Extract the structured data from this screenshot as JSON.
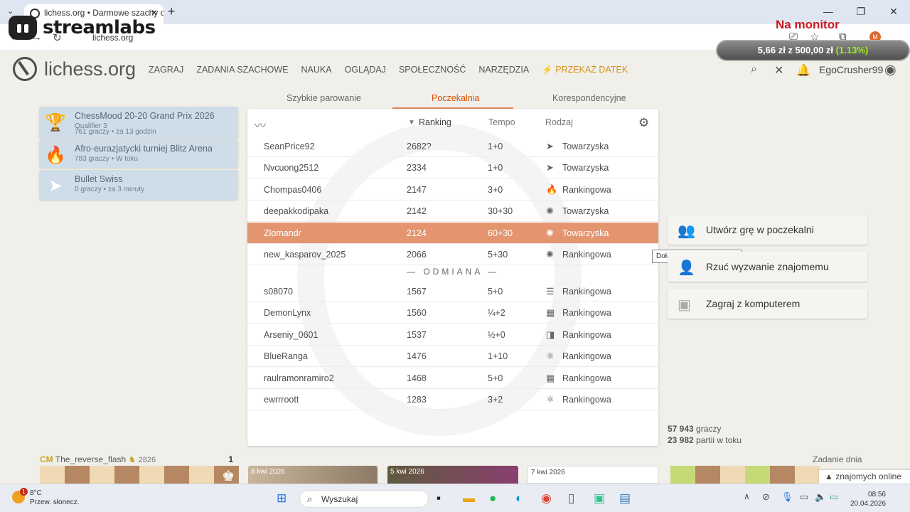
{
  "browser": {
    "tab_title": "lichess.org • Darmowe szachy o",
    "url": "lichess.org",
    "profile_initial": "M"
  },
  "stream": {
    "brand": "streamlabs",
    "monitor_label": "Na monitor",
    "donation_amount": "5,66 zł",
    "donation_goal": "z 500,00 zł",
    "donation_pct": "(1.13%)"
  },
  "site": {
    "logo_text": "lichess.org",
    "nav": [
      "ZAGRAJ",
      "ZADANIA SZACHOWE",
      "NAUKA",
      "OGLĄDAJ",
      "SPOŁECZNOŚĆ",
      "NARZĘDZIA"
    ],
    "donate": "PRZEKAŻ DATEK",
    "username": "EgoCrusher99"
  },
  "lobby_tabs": [
    "Szybkie parowanie",
    "Poczekalnia",
    "Korespondencyjne"
  ],
  "tournaments": [
    {
      "name": "ChessMood 20-20 Grand Prix 2026",
      "sub": "Qualifier 3",
      "info": "761 graczy • za 13 godzin",
      "icon": "trophy-icon",
      "glyph": "🏆"
    },
    {
      "name": "Afro-eurazjatycki turniej Blitz Arena",
      "sub": "",
      "info": "783 graczy • W toku",
      "icon": "flame-icon",
      "glyph": "🔥"
    },
    {
      "name": "Bullet Swiss",
      "sub": "",
      "info": "0 graczy • za 3 minuty",
      "icon": "bullet-icon",
      "glyph": "➤"
    }
  ],
  "table": {
    "headers": {
      "rating": "Ranking",
      "time": "Tempo",
      "mode": "Rodzaj"
    },
    "rows_top": [
      {
        "player": "SeanPrice92",
        "rating": "2682?",
        "time": "1+0",
        "mode": "Towarzyska",
        "glyph": "➤"
      },
      {
        "player": "Nvcuong2512",
        "rating": "2334",
        "time": "1+0",
        "mode": "Towarzyska",
        "glyph": "➤"
      },
      {
        "player": "Chompas0406",
        "rating": "2147",
        "time": "3+0",
        "mode": "Rankingowa",
        "glyph": "🔥"
      },
      {
        "player": "deepakkodipaka",
        "rating": "2142",
        "time": "30+30",
        "mode": "Towarzyska",
        "glyph": "✺"
      },
      {
        "player": "Zlomandr",
        "rating": "2124",
        "time": "60+30",
        "mode": "Towarzyska",
        "glyph": "✺"
      },
      {
        "player": "new_kasparov_2025",
        "rating": "2066",
        "time": "5+30",
        "mode": "Rankingowa",
        "glyph": "✺"
      }
    ],
    "variant_label": "— ODMIANA —",
    "rows_variant": [
      {
        "player": "s08070",
        "rating": "1567",
        "time": "5+0",
        "mode": "Rankingowa",
        "glyph": "☰"
      },
      {
        "player": "DemonLynx",
        "rating": "1560",
        "time": "¼+2",
        "mode": "Rankingowa",
        "glyph": "▦"
      },
      {
        "player": "Arseniy_0601",
        "rating": "1537",
        "time": "½+0",
        "mode": "Rankingowa",
        "glyph": "◨"
      },
      {
        "player": "BlueRanga",
        "rating": "1476",
        "time": "1+10",
        "mode": "Rankingowa",
        "glyph": "⚛"
      },
      {
        "player": "raulramonramiro2",
        "rating": "1468",
        "time": "5+0",
        "mode": "Rankingowa",
        "glyph": "▦"
      },
      {
        "player": "ewrrroott",
        "rating": "1283",
        "time": "3+2",
        "mode": "Rankingowa",
        "glyph": "⚛"
      }
    ]
  },
  "tooltip": "Dołącz do gry | Klasyczne",
  "actions": {
    "create": "Utwórz grę w poczekalni",
    "challenge": "Rzuć wyzwanie znajomemu",
    "computer": "Zagraj z komputerem"
  },
  "stats": {
    "players": "57 943",
    "players_label": "graczy",
    "games": "23 982",
    "games_label": "partii w toku"
  },
  "bottom": {
    "featured_title": "CM",
    "featured_name": "The_reverse_flash",
    "featured_rating": "2826",
    "featured_score": "1",
    "date1": "8 kwi 2026",
    "date2": "5 kwi 2026",
    "date3": "7 kwi 2026",
    "puzzle_label": "Zadanie dnia",
    "friends_label": "znajomych online"
  },
  "taskbar": {
    "temp": "8°C",
    "weather": "Przew. słonecz.",
    "weather_badge": "1",
    "search": "Wyszukaj",
    "time": "08:56",
    "date": "20.04.2026"
  },
  "colors": {
    "accent": "#d85000",
    "highlight_row": "#e4956f",
    "donate": "#d59120"
  }
}
